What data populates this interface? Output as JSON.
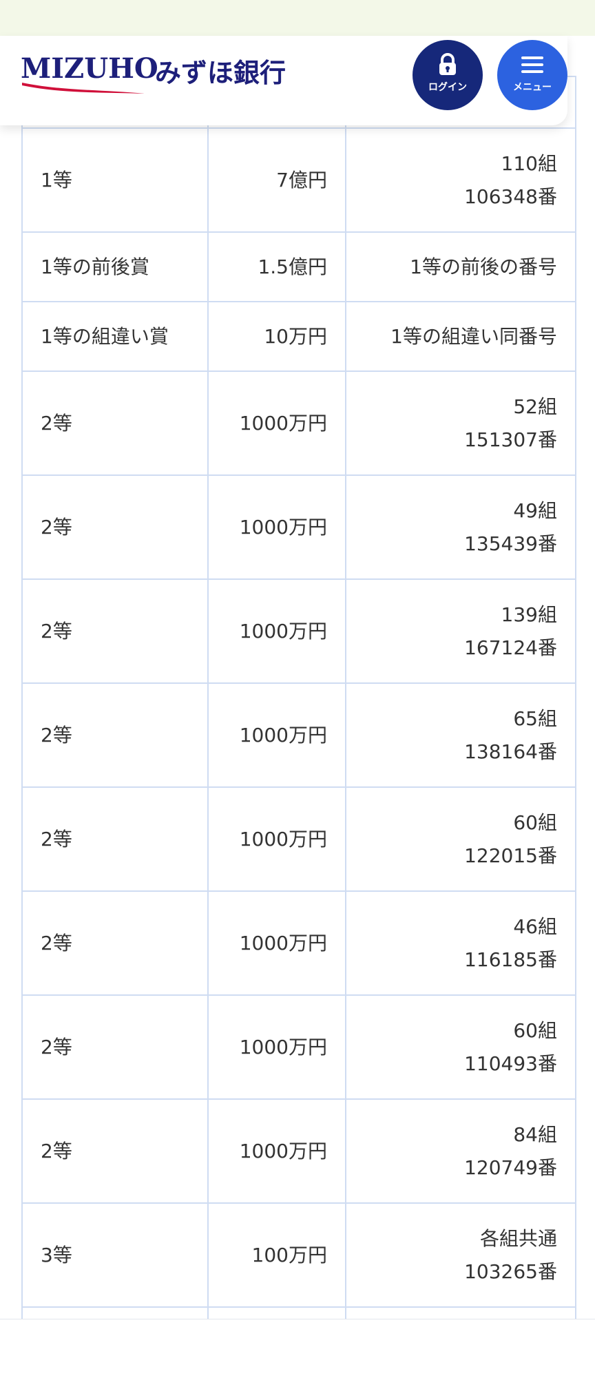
{
  "header": {
    "logo_text": "MIZUHO",
    "bank_name": "みずほ銀行",
    "login_label": "ログイン",
    "menu_label": "メニュー"
  },
  "table": {
    "rows": [
      {
        "prize": "1等",
        "amount": "7億円",
        "number_lines": [
          "110組",
          "106348番"
        ]
      },
      {
        "prize": "1等の前後賞",
        "amount": "1.5億円",
        "number_lines": [
          "1等の前後の番号"
        ]
      },
      {
        "prize": "1等の組違い賞",
        "amount": "10万円",
        "number_lines": [
          "1等の組違い同番号"
        ]
      },
      {
        "prize": "2等",
        "amount": "1000万円",
        "number_lines": [
          "52組",
          "151307番"
        ]
      },
      {
        "prize": "2等",
        "amount": "1000万円",
        "number_lines": [
          "49組",
          "135439番"
        ]
      },
      {
        "prize": "2等",
        "amount": "1000万円",
        "number_lines": [
          "139組",
          "167124番"
        ]
      },
      {
        "prize": "2等",
        "amount": "1000万円",
        "number_lines": [
          "65組",
          "138164番"
        ]
      },
      {
        "prize": "2等",
        "amount": "1000万円",
        "number_lines": [
          "60組",
          "122015番"
        ]
      },
      {
        "prize": "2等",
        "amount": "1000万円",
        "number_lines": [
          "46組",
          "116185番"
        ]
      },
      {
        "prize": "2等",
        "amount": "1000万円",
        "number_lines": [
          "60組",
          "110493番"
        ]
      },
      {
        "prize": "2等",
        "amount": "1000万円",
        "number_lines": [
          "84組",
          "120749番"
        ]
      },
      {
        "prize": "3等",
        "amount": "100万円",
        "number_lines": [
          "各組共通",
          "103265番"
        ]
      }
    ]
  },
  "colors": {
    "brand_navy": "#1d1f7a",
    "login_button": "#16287a",
    "menu_button": "#2c62e0",
    "logo_swoosh": "#d0103a",
    "table_border": "#cfdcf2",
    "top_strip": "#f3f8e8"
  },
  "icons": {
    "login": "lock-icon",
    "menu": "hamburger-menu-icon"
  }
}
